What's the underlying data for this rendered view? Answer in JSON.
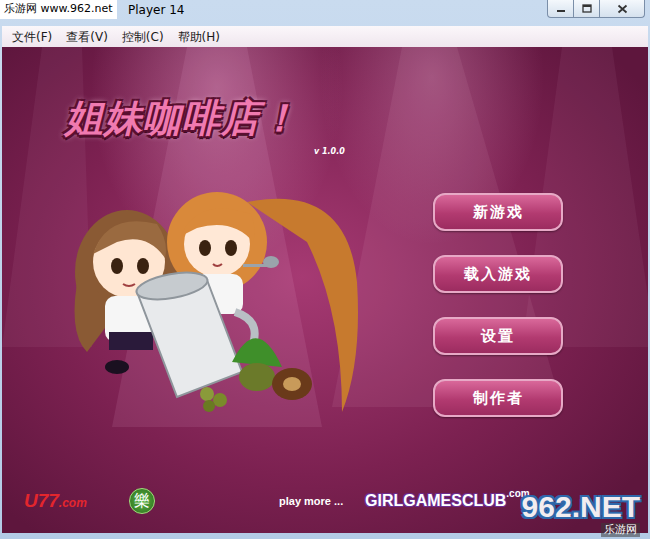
{
  "window": {
    "title": "Player 14"
  },
  "watermark_top": "乐游网 www.962.net",
  "menu": [
    "文件(F)",
    "查看(V)",
    "控制(C)",
    "帮助(H)"
  ],
  "game": {
    "title": "姐妹咖啡店！",
    "version": "v 1.0.0",
    "buttons": [
      "新游戏",
      "载入游戏",
      "设置",
      "制作者"
    ],
    "footer": {
      "sponsor": "U77",
      "sponsor_domain": ".com",
      "logo_char": "樂",
      "play_more": "play more ...",
      "club": "GIRLGAMESCLUB",
      "club_domain": ".com"
    }
  },
  "watermark_bottom": {
    "site": "962.NET",
    "name": "乐游网"
  }
}
